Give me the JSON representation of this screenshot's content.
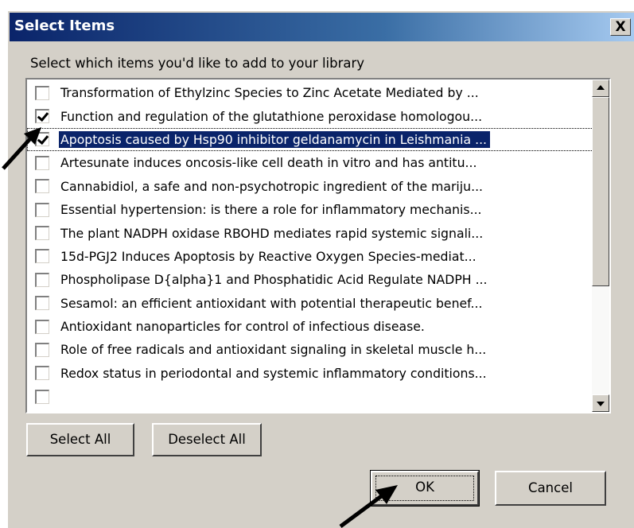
{
  "dialog": {
    "title": "Select Items",
    "close_label": "X",
    "instruction": "Select which items you'd like to add to your library"
  },
  "list": {
    "items": [
      {
        "label": "Transformation of Ethylzinc Species to Zinc Acetate Mediated by ...",
        "checked": false,
        "selected": false
      },
      {
        "label": "Function and regulation of the glutathione peroxidase homologou...",
        "checked": true,
        "selected": false
      },
      {
        "label": "Apoptosis caused by Hsp90 inhibitor geldanamycin in Leishmania ...",
        "checked": true,
        "selected": true
      },
      {
        "label": "Artesunate induces oncosis-like cell death in vitro and has antitu...",
        "checked": false,
        "selected": false
      },
      {
        "label": "Cannabidiol, a safe and non-psychotropic ingredient of the mariju...",
        "checked": false,
        "selected": false
      },
      {
        "label": "Essential hypertension: is there a role for inflammatory mechanis...",
        "checked": false,
        "selected": false
      },
      {
        "label": "The plant NADPH oxidase RBOHD mediates rapid systemic signali...",
        "checked": false,
        "selected": false
      },
      {
        "label": "15d-PGJ2 Induces Apoptosis by Reactive Oxygen Species-mediat...",
        "checked": false,
        "selected": false
      },
      {
        "label": "Phospholipase D{alpha}1 and Phosphatidic Acid Regulate NADPH ...",
        "checked": false,
        "selected": false
      },
      {
        "label": "Sesamol: an efficient antioxidant with potential therapeutic benef...",
        "checked": false,
        "selected": false
      },
      {
        "label": "Antioxidant nanoparticles for control of infectious disease.",
        "checked": false,
        "selected": false
      },
      {
        "label": "Role of free radicals and antioxidant signaling in skeletal muscle h...",
        "checked": false,
        "selected": false
      },
      {
        "label": "Redox status in periodontal and systemic inflammatory conditions...",
        "checked": false,
        "selected": false
      },
      {
        "label": "",
        "checked": false,
        "selected": false
      }
    ]
  },
  "buttons": {
    "select_all": "Select All",
    "deselect_all": "Deselect All",
    "ok": "OK",
    "cancel": "Cancel"
  },
  "colors": {
    "dialog_bg": "#d4d0c8",
    "titlebar_start": "#0a246a",
    "titlebar_end": "#a6caf0",
    "selection_bg": "#0a246a",
    "selection_fg": "#ffffff"
  }
}
